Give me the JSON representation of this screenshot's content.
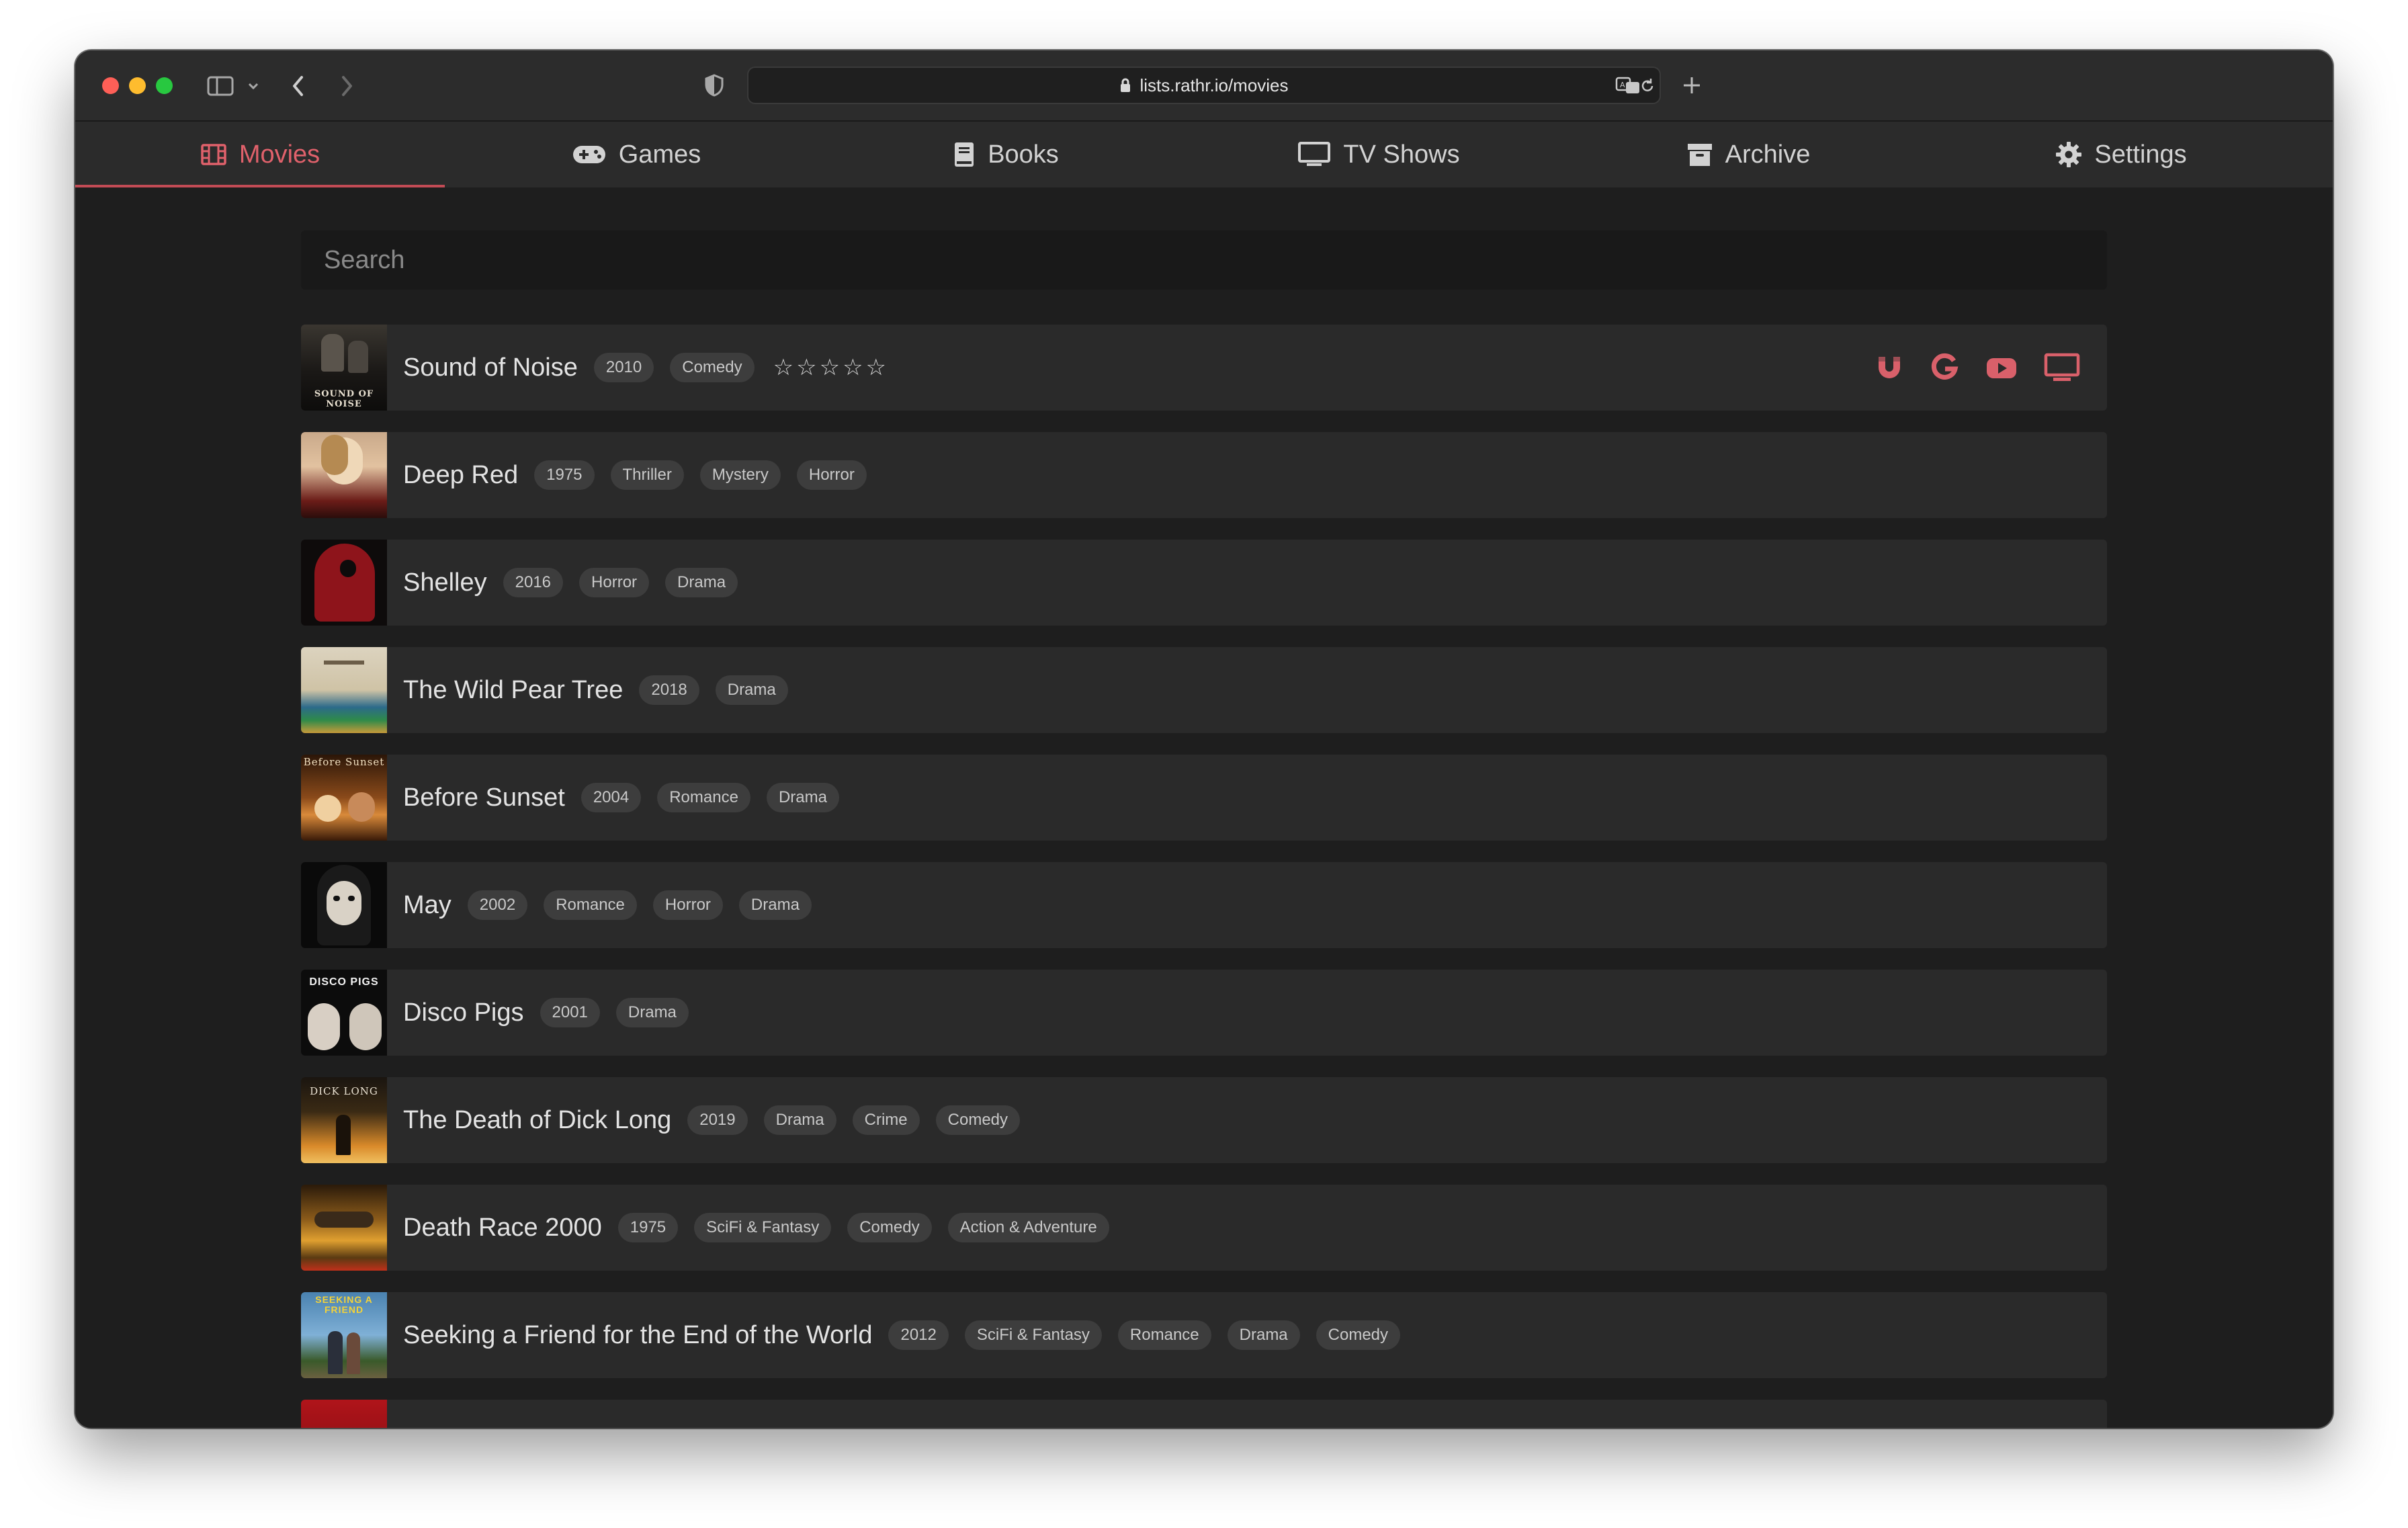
{
  "browser": {
    "url": "lists.rathr.io/movies"
  },
  "nav": {
    "items": [
      {
        "label": "Movies",
        "icon": "film-icon",
        "active": true
      },
      {
        "label": "Games",
        "icon": "gamepad-icon",
        "active": false
      },
      {
        "label": "Books",
        "icon": "book-icon",
        "active": false
      },
      {
        "label": "TV Shows",
        "icon": "tv-icon",
        "active": false
      },
      {
        "label": "Archive",
        "icon": "archive-icon",
        "active": false
      },
      {
        "label": "Settings",
        "icon": "gear-icon",
        "active": false
      }
    ]
  },
  "search": {
    "placeholder": "Search"
  },
  "movies": [
    {
      "title": "Sound of Noise",
      "year": "2010",
      "genres": [
        "Comedy"
      ],
      "rating_stars": 0,
      "rating_max": 5,
      "poster_text": "SOUND OF NOISE"
    },
    {
      "title": "Deep Red",
      "year": "1975",
      "genres": [
        "Thriller",
        "Mystery",
        "Horror"
      ]
    },
    {
      "title": "Shelley",
      "year": "2016",
      "genres": [
        "Horror",
        "Drama"
      ]
    },
    {
      "title": "The Wild Pear Tree",
      "year": "2018",
      "genres": [
        "Drama"
      ]
    },
    {
      "title": "Before Sunset",
      "year": "2004",
      "genres": [
        "Romance",
        "Drama"
      ],
      "poster_text": "Before Sunset"
    },
    {
      "title": "May",
      "year": "2002",
      "genres": [
        "Romance",
        "Horror",
        "Drama"
      ]
    },
    {
      "title": "Disco Pigs",
      "year": "2001",
      "genres": [
        "Drama"
      ],
      "poster_text": "DISCO PIGS"
    },
    {
      "title": "The Death of Dick Long",
      "year": "2019",
      "genres": [
        "Drama",
        "Crime",
        "Comedy"
      ],
      "poster_text": "DICK LONG"
    },
    {
      "title": "Death Race 2000",
      "year": "1975",
      "genres": [
        "SciFi & Fantasy",
        "Comedy",
        "Action & Adventure"
      ]
    },
    {
      "title": "Seeking a Friend for the End of the World",
      "year": "2012",
      "genres": [
        "SciFi & Fantasy",
        "Romance",
        "Drama",
        "Comedy"
      ],
      "poster_text": "SEEKING A FRIEND"
    }
  ],
  "row_actions": [
    "magnet-icon",
    "google-icon",
    "youtube-icon",
    "tv-icon"
  ],
  "colors": {
    "accent": "#e0616b",
    "background": "#1e1e1e",
    "row": "#2a2a2a",
    "chip": "#3d3d3d",
    "nav": "#2b2b2b"
  }
}
